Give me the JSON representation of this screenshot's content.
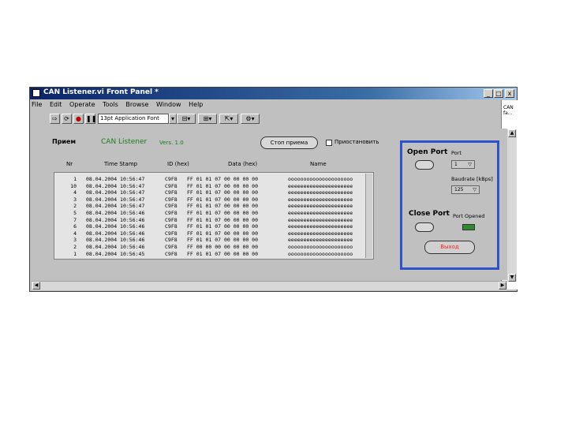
{
  "window": {
    "title": "CAN Listener.vi Front Panel *",
    "controls": {
      "minimize": "_",
      "maximize": "□",
      "close": "x"
    }
  },
  "menu": [
    "File",
    "Edit",
    "Operate",
    "Tools",
    "Browse",
    "Window",
    "Help"
  ],
  "toolbar": {
    "font_select": "13pt Application Font"
  },
  "context_help": "CAN\nfa...",
  "panel": {
    "heading": "Прием",
    "app_name": "CAN Listener",
    "version": "Vers. 1.0",
    "stop_button": "Стоп приема",
    "pause_checkbox": "Приостановить",
    "columns": [
      "Nr",
      "Time Stamp",
      "ID (hex)",
      "Data (hex)",
      "Name"
    ]
  },
  "rows": [
    [
      "1",
      "08.04.2004  10:56:47",
      "C9F8",
      "FF 01 01 07 00 00 00 00",
      "ooooooooooooooooooooo"
    ],
    [
      "10",
      "08.04.2004  10:56:47",
      "C9F8",
      "FF 01 01 07 00 00 00 00",
      "eeeeeeeeeeeeeeeeeeeee"
    ],
    [
      "4",
      "08.04.2004  10:56:47",
      "C9F8",
      "FF 01 01 07 00 00 00 00",
      "eeeeeeeeeeeeeeeeeeeee"
    ],
    [
      "3",
      "08.04.2004  10:56:47",
      "C9F8",
      "FF 01 01 07 00 00 00 00",
      "eeeeeeeeeeeeeeeeeeeee"
    ],
    [
      "2",
      "08.04.2004  10:56:47",
      "C9F8",
      "FF 01 01 07 00 00 00 00",
      "eeeeeeeeeeeeeeeeeeeee"
    ],
    [
      "5",
      "08.04.2004  10:56:46",
      "C9F8",
      "FF 01 01 07 00 00 00 00",
      "eeeeeeeeeeeeeeeeeeeee"
    ],
    [
      "7",
      "08.04.2004  10:56:46",
      "C9F8",
      "FF 01 01 07 00 00 00 00",
      "eeeeeeeeeeeeeeeeeeeee"
    ],
    [
      "6",
      "08.04.2004  10:56:46",
      "C9F8",
      "FF 01 01 07 00 00 00 00",
      "eeeeeeeeeeeeeeeeeeeee"
    ],
    [
      "4",
      "08.04.2004  10:56:46",
      "C9F8",
      "FF 01 01 07 00 00 00 00",
      "eeeeeeeeeeeeeeeeeeeee"
    ],
    [
      "3",
      "08.04.2004  10:56:46",
      "C9F8",
      "FF 01 01 07 00 00 00 00",
      "eeeeeeeeeeeeeeeeeeeee"
    ],
    [
      "2",
      "08.04.2004  10:56:46",
      "C9F8",
      "FF 00 00 00 00 00 00 00",
      "ooooooooooooooooooooo"
    ],
    [
      "1",
      "08.04.2004  10:56:45",
      "C9F8",
      "FF 01 01 07 00 00 00 00",
      "ooooooooooooooooooooo"
    ]
  ],
  "port_box": {
    "open_title": "Open Port",
    "port_label": "Port",
    "port_value": "1",
    "baud_label": "Baudrate [kBps]",
    "baud_value": "125",
    "close_title": "Close Port",
    "port_opened_label": "Port Opened",
    "led_on": true,
    "led_color": "#2e8b2e",
    "exit_button": "Выход",
    "exit_color": "#ff2020"
  },
  "accent": "#2f52c8"
}
